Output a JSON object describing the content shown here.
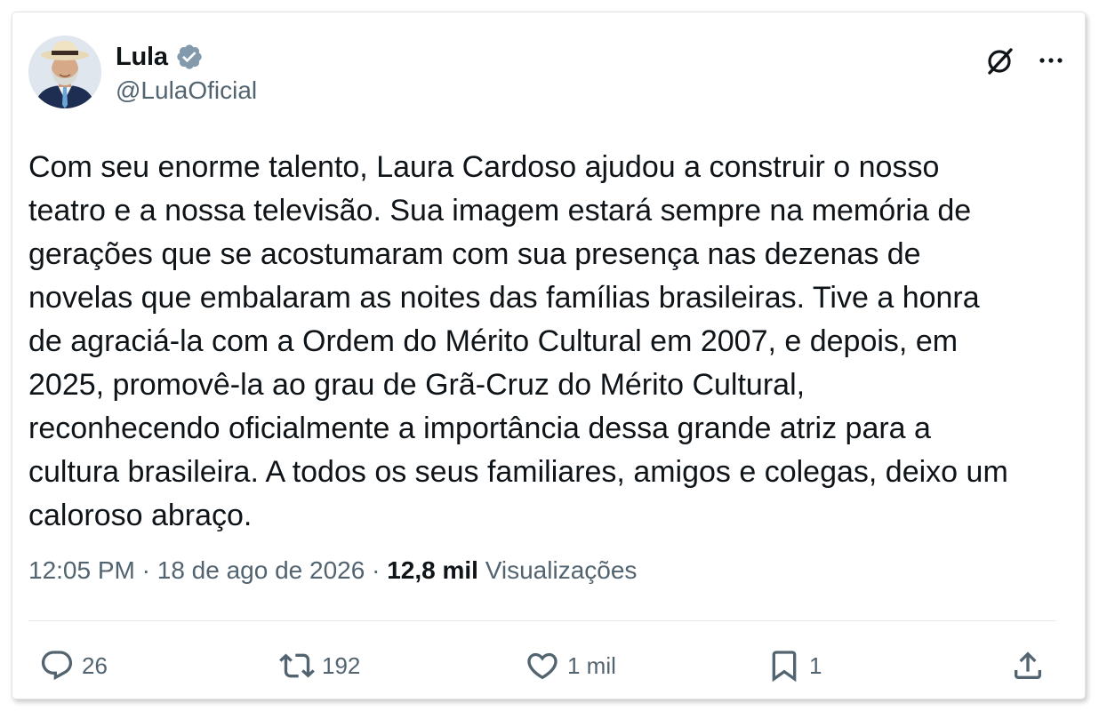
{
  "author": {
    "display_name": "Lula",
    "handle": "@LulaOficial",
    "verified": true,
    "verified_color": "#829aab"
  },
  "header_icons": {
    "grok": "grok-icon",
    "more": "more-icon"
  },
  "tweet": {
    "text": "Com seu enorme talento, Laura Cardoso ajudou a construir o nosso\nteatro e a nossa televisão. Sua imagem estará sempre na memória de\ngerações que se acostumaram com sua presença nas dezenas de\nnovelas que embalaram as noites das famílias brasileiras. Tive a honra\nde agraciá-la com a Ordem do Mérito Cultural em 2007, e depois, em\n2025, promovê-la ao grau de Grã-Cruz do Mérito Cultural,\nreconhecendo oficialmente a importância dessa grande atriz para a\ncultura brasileira. A todos os seus familiares, amigos e colegas, deixo um\ncaloroso abraço."
  },
  "meta": {
    "time": "12:05 PM",
    "separator": "·",
    "date": "18 de ago de 2026",
    "views_count": "12,8 mil",
    "views_label": "Visualizações"
  },
  "actions": {
    "replies": "26",
    "reposts": "192",
    "likes": "1 mil",
    "bookmarks": "1"
  },
  "colors": {
    "text": "#0f1419",
    "secondary": "#536471"
  }
}
